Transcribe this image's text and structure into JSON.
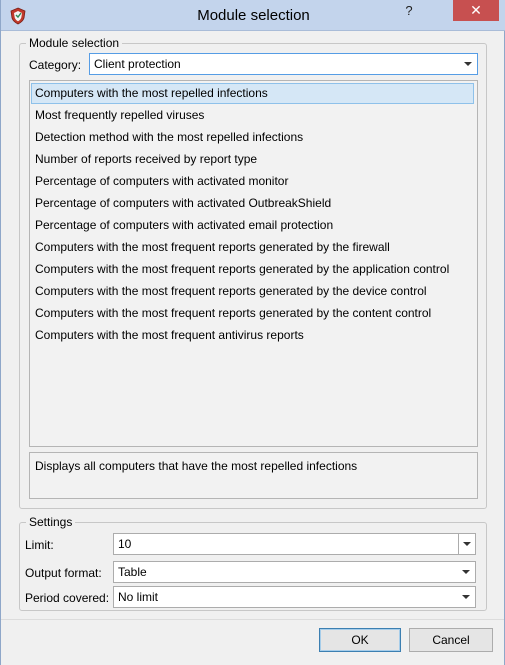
{
  "window": {
    "title": "Module selection",
    "help_label": "?",
    "close_label": "✕",
    "icon": "shield-app-icon"
  },
  "module_selection": {
    "group_label": "Module selection",
    "category_label": "Category:",
    "category_value": "Client protection",
    "items": [
      {
        "label": "Computers with the most repelled infections",
        "selected": true
      },
      {
        "label": "Most frequently repelled viruses",
        "selected": false
      },
      {
        "label": "Detection method with the most repelled infections",
        "selected": false
      },
      {
        "label": "Number of reports received by report type",
        "selected": false
      },
      {
        "label": "Percentage of computers with activated monitor",
        "selected": false
      },
      {
        "label": "Percentage of computers with activated OutbreakShield",
        "selected": false
      },
      {
        "label": "Percentage of computers with activated email protection",
        "selected": false
      },
      {
        "label": "Computers with the most frequent reports generated by the firewall",
        "selected": false
      },
      {
        "label": "Computers with the most frequent reports generated by the application control",
        "selected": false
      },
      {
        "label": "Computers with the most frequent reports generated by the device control",
        "selected": false
      },
      {
        "label": "Computers with the most frequent reports generated by the content control",
        "selected": false
      },
      {
        "label": "Computers with the most frequent antivirus reports",
        "selected": false
      }
    ],
    "description": "Displays all computers that have the most repelled infections"
  },
  "settings": {
    "group_label": "Settings",
    "limit_label": "Limit:",
    "limit_value": "10",
    "output_format_label": "Output format:",
    "output_format_value": "Table",
    "period_label": "Period covered:",
    "period_value": "No limit"
  },
  "buttons": {
    "ok": "OK",
    "cancel": "Cancel"
  },
  "colors": {
    "titlebar": "#c3d4ec",
    "close_button": "#c75050",
    "selection": "#d5e7f6",
    "focus_border": "#569de5"
  }
}
